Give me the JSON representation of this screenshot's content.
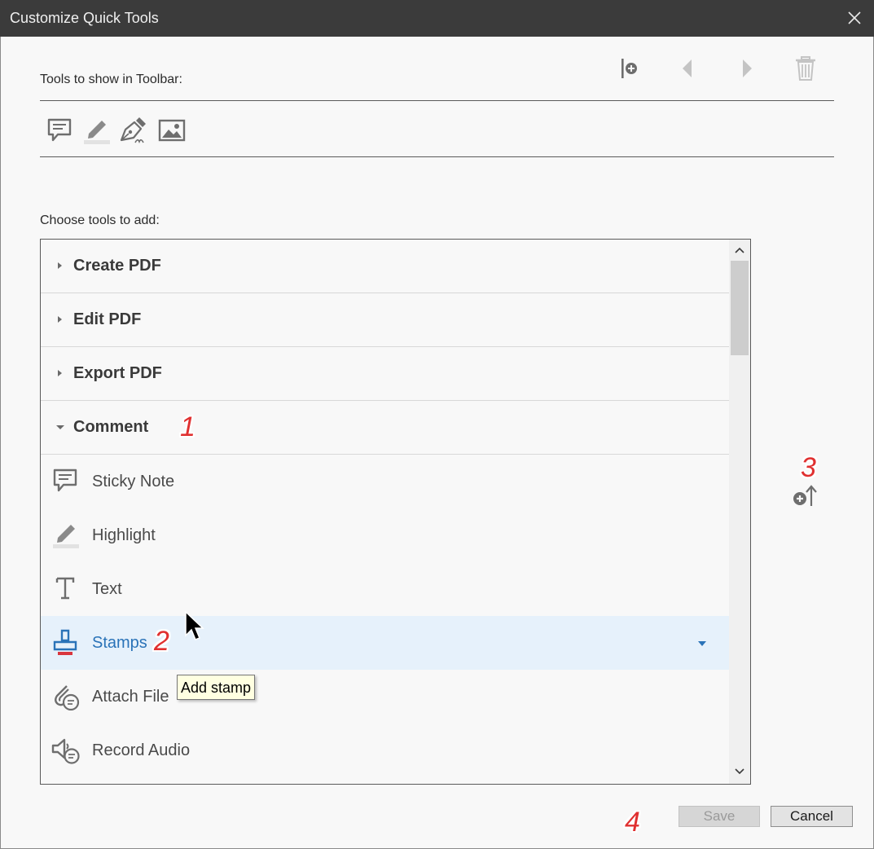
{
  "window": {
    "title": "Customize Quick Tools"
  },
  "toolbar_section": {
    "label": "Tools to show in Toolbar:",
    "actions": [
      "add-divider-icon",
      "move-left-icon",
      "move-right-icon",
      "delete-icon"
    ],
    "quick_tools": [
      "sticky-note-icon",
      "highlight-icon",
      "sign-icon",
      "image-icon"
    ]
  },
  "choose_section": {
    "label": "Choose tools to add:",
    "categories": [
      {
        "label": "Create PDF",
        "expanded": false
      },
      {
        "label": "Edit PDF",
        "expanded": false
      },
      {
        "label": "Export PDF",
        "expanded": false
      },
      {
        "label": "Comment",
        "expanded": true
      }
    ],
    "tools": [
      {
        "label": "Sticky Note",
        "icon": "sticky-note-icon"
      },
      {
        "label": "Highlight",
        "icon": "highlight-icon"
      },
      {
        "label": "Text",
        "icon": "text-icon"
      },
      {
        "label": "Stamps",
        "icon": "stamp-icon",
        "selected": true
      },
      {
        "label": "Attach File",
        "icon": "attach-file-icon"
      },
      {
        "label": "Record Audio",
        "icon": "record-audio-icon"
      }
    ]
  },
  "tooltip": "Add stamp",
  "annotations": {
    "a1": "1",
    "a2": "2",
    "a3": "3",
    "a4": "4"
  },
  "buttons": {
    "save": "Save",
    "cancel": "Cancel"
  },
  "colors": {
    "titlebar": "#3b3b3b",
    "selected_row": "#e6f1fb",
    "selected_text": "#2a73b8",
    "annotation": "#e03030",
    "tooltip_bg": "#ffffe1"
  }
}
